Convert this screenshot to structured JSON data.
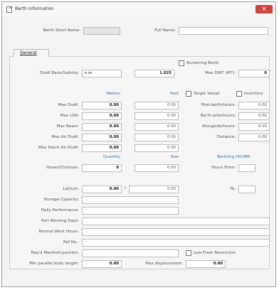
{
  "window": {
    "title": "Berth Information",
    "close": "×"
  },
  "header": {
    "short_name_label": "Berth Short Name:",
    "short_name_value": "",
    "full_name_label": "Full Name:",
    "full_name_value": ""
  },
  "tab": {
    "label": "General"
  },
  "bunkering": {
    "label": "Bunkering Berth",
    "checked": false
  },
  "draft_basis": {
    "label": "Draft Basis/Salinity:",
    "value": "n.m",
    "salinity": "1.025"
  },
  "max_dwt": {
    "label": "Max DWT (MT):",
    "value": "0"
  },
  "columns": {
    "meters": "Meters",
    "feet": "Feet"
  },
  "single_vessel": {
    "label": "Single Vessel",
    "checked": false
  },
  "inventory": {
    "label": "Inventory",
    "checked": false
  },
  "dimension_rows": [
    {
      "label": "Max Draft:",
      "meters": "0.00",
      "feet": "0.00"
    },
    {
      "label": "Max LOA:",
      "meters": "0.00",
      "feet": "0.00"
    },
    {
      "label": "Max Beam:",
      "meters": "0.00",
      "feet": "0.00"
    },
    {
      "label": "Max Air Draft:",
      "meters": "0.00",
      "feet": "0.00"
    },
    {
      "label": "Max Hatch Air Draft:",
      "meters": "0.00",
      "feet": "0.00"
    }
  ],
  "pilot_rows": [
    {
      "label": "Pilot-berth/hours:",
      "value": "0.00"
    },
    {
      "label": "Berth-pilot/hours:",
      "value": "0.00"
    },
    {
      "label": "Alongside/hours:",
      "value": "0.00"
    },
    {
      "label": "Distance:",
      "value": "0.00"
    }
  ],
  "sub_headers": {
    "quantity": "Quantity",
    "size": "Size",
    "berthing": "Berthing HH:MM"
  },
  "hoses": {
    "label": "Hoses/Chicksan:",
    "quantity": "0",
    "size": "0.00"
  },
  "hours_from": {
    "label": "Hours From:",
    "value": ""
  },
  "latlon": {
    "label": "Lat/Lon:",
    "lat": "0.00",
    "lon": "0.00"
  },
  "to": {
    "label": "To:",
    "value": ""
  },
  "text_fields": [
    {
      "label": "Storage Capacity:",
      "value": ""
    },
    {
      "label": "Daily Performance:",
      "value": ""
    },
    {
      "label": "Port Working Days:",
      "value": ""
    },
    {
      "label": "Normal Work Hours:",
      "value": ""
    },
    {
      "label": "Ref No.:",
      "value": ""
    }
  ],
  "manifold": {
    "label": "Req'd Manifold position:",
    "value": ""
  },
  "low_flash": {
    "label": "Low Flash Restriction",
    "checked": false
  },
  "parallel_body": {
    "label": "Min parallel body length:",
    "value": "0.00"
  },
  "max_displacement": {
    "label": "Max displacement:",
    "value": "0.00"
  },
  "colors": {
    "close_button": "#c9463d",
    "header_blue": "#3a6fb0"
  }
}
